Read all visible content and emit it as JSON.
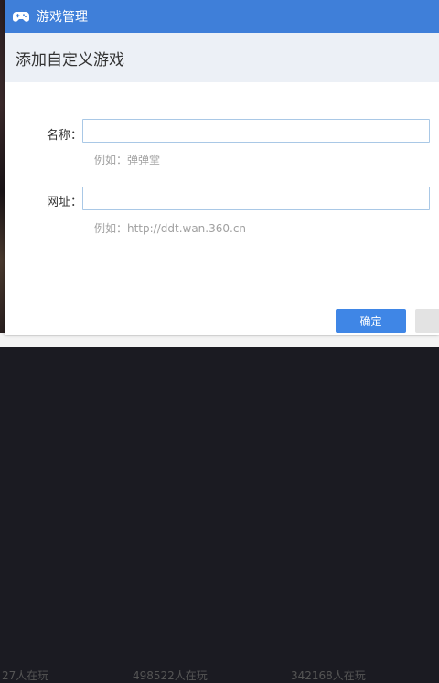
{
  "window": {
    "title": "游戏管理",
    "icon": "gamepad-icon"
  },
  "dialog": {
    "heading": "添加自定义游戏",
    "name_field": {
      "label": "名称：",
      "value": "",
      "hint": "例如：弹弹堂"
    },
    "url_field": {
      "label": "网址：",
      "value": "",
      "hint": "例如：http://ddt.wan.360.cn"
    },
    "buttons": {
      "confirm": "确定",
      "cancel": ""
    }
  },
  "background": {
    "player_counts": [
      "27人在玩",
      "498522人在玩",
      "342168人在玩"
    ]
  },
  "colors": {
    "titlebar": "#3f7fd9",
    "primary_button": "#3f86e6",
    "header_bg": "#ecf0f6"
  }
}
